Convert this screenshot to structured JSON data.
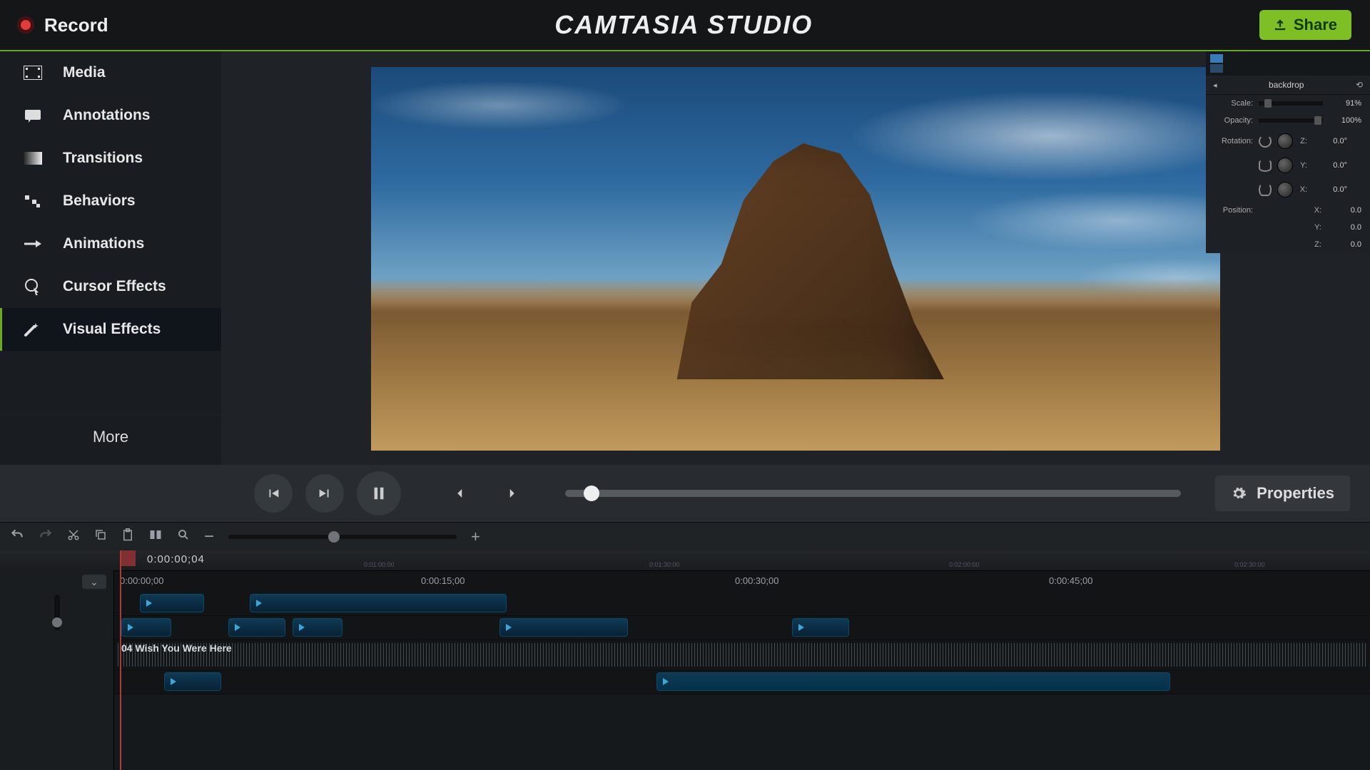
{
  "topbar": {
    "record": "Record",
    "title": "CAMTASIA STUDIO",
    "share": "Share"
  },
  "sidebar": {
    "items": [
      {
        "label": "Media"
      },
      {
        "label": "Annotations"
      },
      {
        "label": "Transitions"
      },
      {
        "label": "Behaviors"
      },
      {
        "label": "Animations"
      },
      {
        "label": "Cursor Effects"
      },
      {
        "label": "Visual Effects"
      }
    ],
    "more": "More"
  },
  "properties_button": "Properties",
  "properties_panel": {
    "name": "backdrop",
    "scale": {
      "label": "Scale:",
      "value": "91%"
    },
    "opacity": {
      "label": "Opacity:",
      "value": "100%"
    },
    "rotation": {
      "label": "Rotation:",
      "z": {
        "axis": "Z:",
        "value": "0.0°"
      },
      "y": {
        "axis": "Y:",
        "value": "0.0°"
      },
      "x": {
        "axis": "X:",
        "value": "0.0°"
      }
    },
    "position": {
      "label": "Position:",
      "x": {
        "axis": "X:",
        "value": "0.0"
      },
      "y": {
        "axis": "Y:",
        "value": "0.0"
      },
      "z": {
        "axis": "Z:",
        "value": "0.0"
      }
    }
  },
  "timeline": {
    "timecode": "0:00:00;04",
    "ruler": [
      "0:00:00;00",
      "0:00:15;00",
      "0:00:30;00",
      "0:00:45;00"
    ],
    "mini_ruler": [
      "0:01:00:00",
      "0:01:30:00",
      "0:02:00:00",
      "0:02:30:00"
    ],
    "audio_clip": "04 Wish You Were Here"
  }
}
